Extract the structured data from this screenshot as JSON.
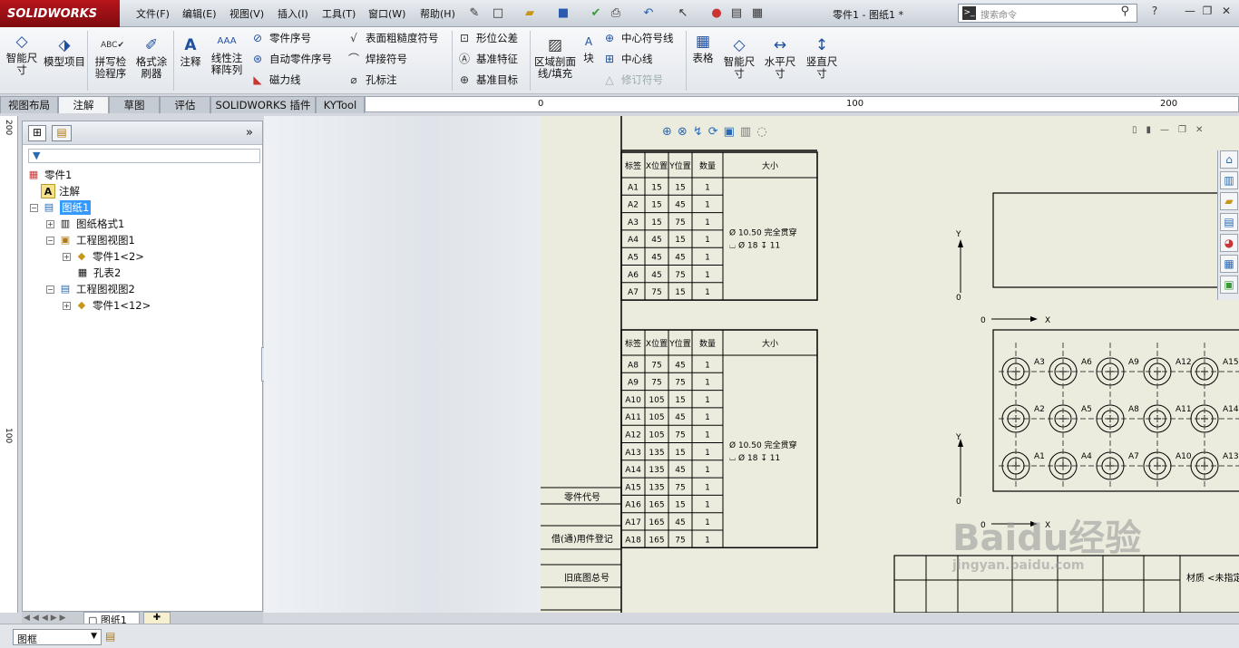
{
  "app": {
    "logo_text": "SOLIDWORKS",
    "doc_title": "零件1 - 图纸1 *",
    "menus": [
      "文件(F)",
      "编辑(E)",
      "视图(V)",
      "插入(I)",
      "工具(T)",
      "窗口(W)",
      "帮助(H)"
    ],
    "search_placeholder": "搜索命令",
    "help_icon": "?"
  },
  "ribbon": {
    "smart_dim": "智能尺寸",
    "model_items": "模型项目",
    "spell_check": "拼写检验程序",
    "format_painter": "格式涂刷器",
    "note": "注释",
    "linear_pattern": "线性注释阵列",
    "balloon": "零件序号",
    "auto_balloon": "自动零件序号",
    "magnetic_line": "磁力线",
    "surface_finish": "表面粗糙度符号",
    "weld_symbol": "焊接符号",
    "hole_callout": "孔标注",
    "gtol": "形位公差",
    "datum_feature": "基准特征",
    "datum_target": "基准目标",
    "area_hatch": "区域剖面线/填充",
    "block": "块",
    "centermark": "中心符号线",
    "centerline": "中心线",
    "revision": "修订符号",
    "tables": "表格",
    "smart_dim2": "智能尺寸",
    "horizontal_dim": "水平尺寸",
    "vertical_dim": "竖直尺寸"
  },
  "tabs": [
    "视图布局",
    "注解",
    "草图",
    "评估",
    "SOLIDWORKS 插件",
    "KYTool"
  ],
  "ruler": {
    "top": [
      "0",
      "100",
      "200"
    ],
    "left": [
      "200",
      "100"
    ]
  },
  "tree": {
    "items": [
      {
        "label": "零件1",
        "indent": 0,
        "icon": "drawing-icon"
      },
      {
        "label": "注解",
        "indent": 1,
        "icon": "annotation-icon"
      },
      {
        "label": "图纸1",
        "indent": 1,
        "icon": "sheet-icon",
        "selected": true
      },
      {
        "label": "图纸格式1",
        "indent": 2,
        "icon": "format-icon"
      },
      {
        "label": "工程图视图1",
        "indent": 2,
        "icon": "view-icon"
      },
      {
        "label": "零件1<2>",
        "indent": 3,
        "icon": "part-icon"
      },
      {
        "label": "孔表2",
        "indent": 3,
        "icon": "table-icon"
      },
      {
        "label": "工程图视图2",
        "indent": 2,
        "icon": "view-icon"
      },
      {
        "label": "零件1<12>",
        "indent": 3,
        "icon": "part-icon"
      }
    ]
  },
  "hole_table1": {
    "headers": [
      "标签",
      "X位置",
      "Y位置",
      "数量",
      "大小"
    ],
    "rows": [
      [
        "A1",
        "15",
        "15",
        "1"
      ],
      [
        "A2",
        "15",
        "45",
        "1"
      ],
      [
        "A3",
        "15",
        "75",
        "1"
      ],
      [
        "A4",
        "45",
        "15",
        "1"
      ],
      [
        "A5",
        "45",
        "45",
        "1"
      ],
      [
        "A6",
        "45",
        "75",
        "1"
      ],
      [
        "A7",
        "75",
        "15",
        "1"
      ]
    ],
    "size_line1": "Ø 10.50 完全贯穿",
    "size_line2": "⌴ Ø 18 ↧ 11"
  },
  "hole_table2": {
    "headers": [
      "标签",
      "X位置",
      "Y位置",
      "数量",
      "大小"
    ],
    "rows": [
      [
        "A8",
        "75",
        "45",
        "1"
      ],
      [
        "A9",
        "75",
        "75",
        "1"
      ],
      [
        "A10",
        "105",
        "15",
        "1"
      ],
      [
        "A11",
        "105",
        "45",
        "1"
      ],
      [
        "A12",
        "105",
        "75",
        "1"
      ],
      [
        "A13",
        "135",
        "15",
        "1"
      ],
      [
        "A14",
        "135",
        "45",
        "1"
      ],
      [
        "A15",
        "135",
        "75",
        "1"
      ],
      [
        "A16",
        "165",
        "15",
        "1"
      ],
      [
        "A17",
        "165",
        "45",
        "1"
      ],
      [
        "A18",
        "165",
        "75",
        "1"
      ]
    ],
    "size_line1": "Ø 10.50 完全贯穿",
    "size_line2": "⌴ Ø 18 ↧ 11"
  },
  "side_labels": [
    "零件代号",
    "借(通)用件登记",
    "旧底图总号"
  ],
  "view_labels": {
    "y_axis": "Y",
    "x_axis": "X",
    "origin": "0",
    "holes_row_top": [
      "A3",
      "A6",
      "A9",
      "A12",
      "A15"
    ],
    "holes_row_mid": [
      "A2",
      "A5",
      "A8",
      "A11",
      "A14"
    ],
    "holes_row_bot": [
      "A1",
      "A4",
      "A7",
      "A10",
      "A13"
    ]
  },
  "title_block_text": "材质 <未指定>",
  "sheet_tab": "图纸1",
  "status": {
    "dropdown_value": "图框"
  },
  "watermark": {
    "line1": "Baidu经验",
    "line2": "jingyan.baidu.com"
  }
}
